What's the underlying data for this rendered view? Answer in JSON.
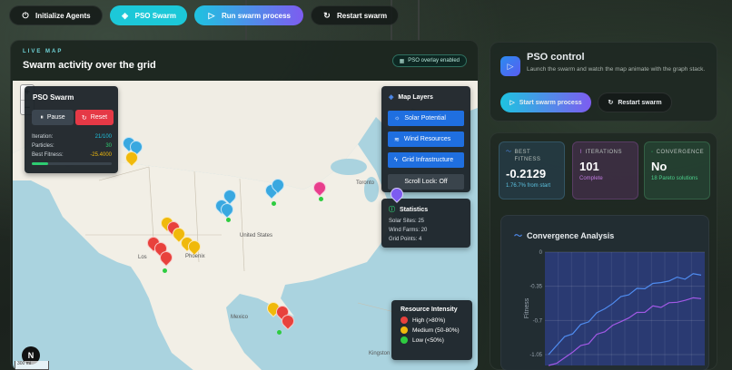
{
  "toolbar": {
    "init_label": "Initialize Agents",
    "pso_label": "PSO Swarm",
    "run_label": "Run swarm process",
    "restart_label": "Restart swarm"
  },
  "map_card": {
    "eyebrow": "LIVE MAP",
    "title": "Swarm activity over the grid",
    "overlay_badge": "PSO overlay enabled"
  },
  "pso_panel": {
    "title": "PSO Swarm",
    "pause_label": "Pause",
    "reset_label": "Reset",
    "iteration_label": "Iteration:",
    "iteration_value": "21/100",
    "particles_label": "Particles:",
    "particles_value": "30",
    "fitness_label": "Best Fitness:",
    "fitness_value": "-25.4000",
    "fitness_progress": 0.2
  },
  "layers": {
    "title": "Map Layers",
    "solar": "Solar Potential",
    "wind": "Wind Resources",
    "grid": "Grid Infrastructure",
    "scroll_lock": "Scroll Lock: Off"
  },
  "statistics": {
    "title": "Statistics",
    "solar": "Solar Sites: 25",
    "wind": "Wind Farms: 20",
    "grid": "Grid Points: 4"
  },
  "intensity": {
    "title": "Resource Intensity",
    "high": "High (>80%)",
    "medium": "Medium (50-80%)",
    "low": "Low (<50%)",
    "colors": {
      "high": "#e8413c",
      "medium": "#f0b90b",
      "low": "#2ecc40"
    }
  },
  "map_labels": {
    "toronto": "Toronto",
    "united_states": "United States",
    "mexico": "Mexico",
    "kingston": "Kingston",
    "la": "Los",
    "phoenix": "Phoenix",
    "scale_km": "",
    "scale_mi": "300 mi"
  },
  "n_button": "N",
  "pso_control": {
    "title": "PSO control",
    "description": "Launch the swarm and watch the map animate with the graph stack.",
    "start_label": "Start swarm process",
    "restart_label": "Restart swarm"
  },
  "metrics": {
    "best_label": "BEST FITNESS",
    "best_value": "-0.2129",
    "best_sub": "1.76.7% from start",
    "iter_label": "ITERATIONS",
    "iter_value": "101",
    "iter_sub": "Complete",
    "conv_label": "CONVERGENCE",
    "conv_value": "No",
    "conv_sub": "18 Pareto solutions"
  },
  "chart_data": {
    "type": "line",
    "title": "Convergence Analysis",
    "ylabel": "Fitness",
    "xlabel": "",
    "ylim": [
      -1.05,
      0
    ],
    "yticks": [
      "0",
      "-0.35",
      "-0.7",
      "-1.05"
    ],
    "series": [
      {
        "color": "#4f8cf0",
        "values": [
          -1.05,
          -0.95,
          -0.88,
          -0.82,
          -0.76,
          -0.7,
          -0.63,
          -0.58,
          -0.52,
          -0.47,
          -0.42,
          -0.39,
          -0.36,
          -0.33,
          -0.31,
          -0.29,
          -0.27,
          -0.26,
          -0.24,
          -0.22
        ]
      },
      {
        "color": "#a259e6",
        "values": [
          -1.22,
          -1.15,
          -1.08,
          -1.02,
          -0.97,
          -0.92,
          -0.86,
          -0.8,
          -0.76,
          -0.71,
          -0.67,
          -0.63,
          -0.6,
          -0.57,
          -0.55,
          -0.53,
          -0.51,
          -0.49,
          -0.48,
          -0.46
        ]
      }
    ]
  }
}
